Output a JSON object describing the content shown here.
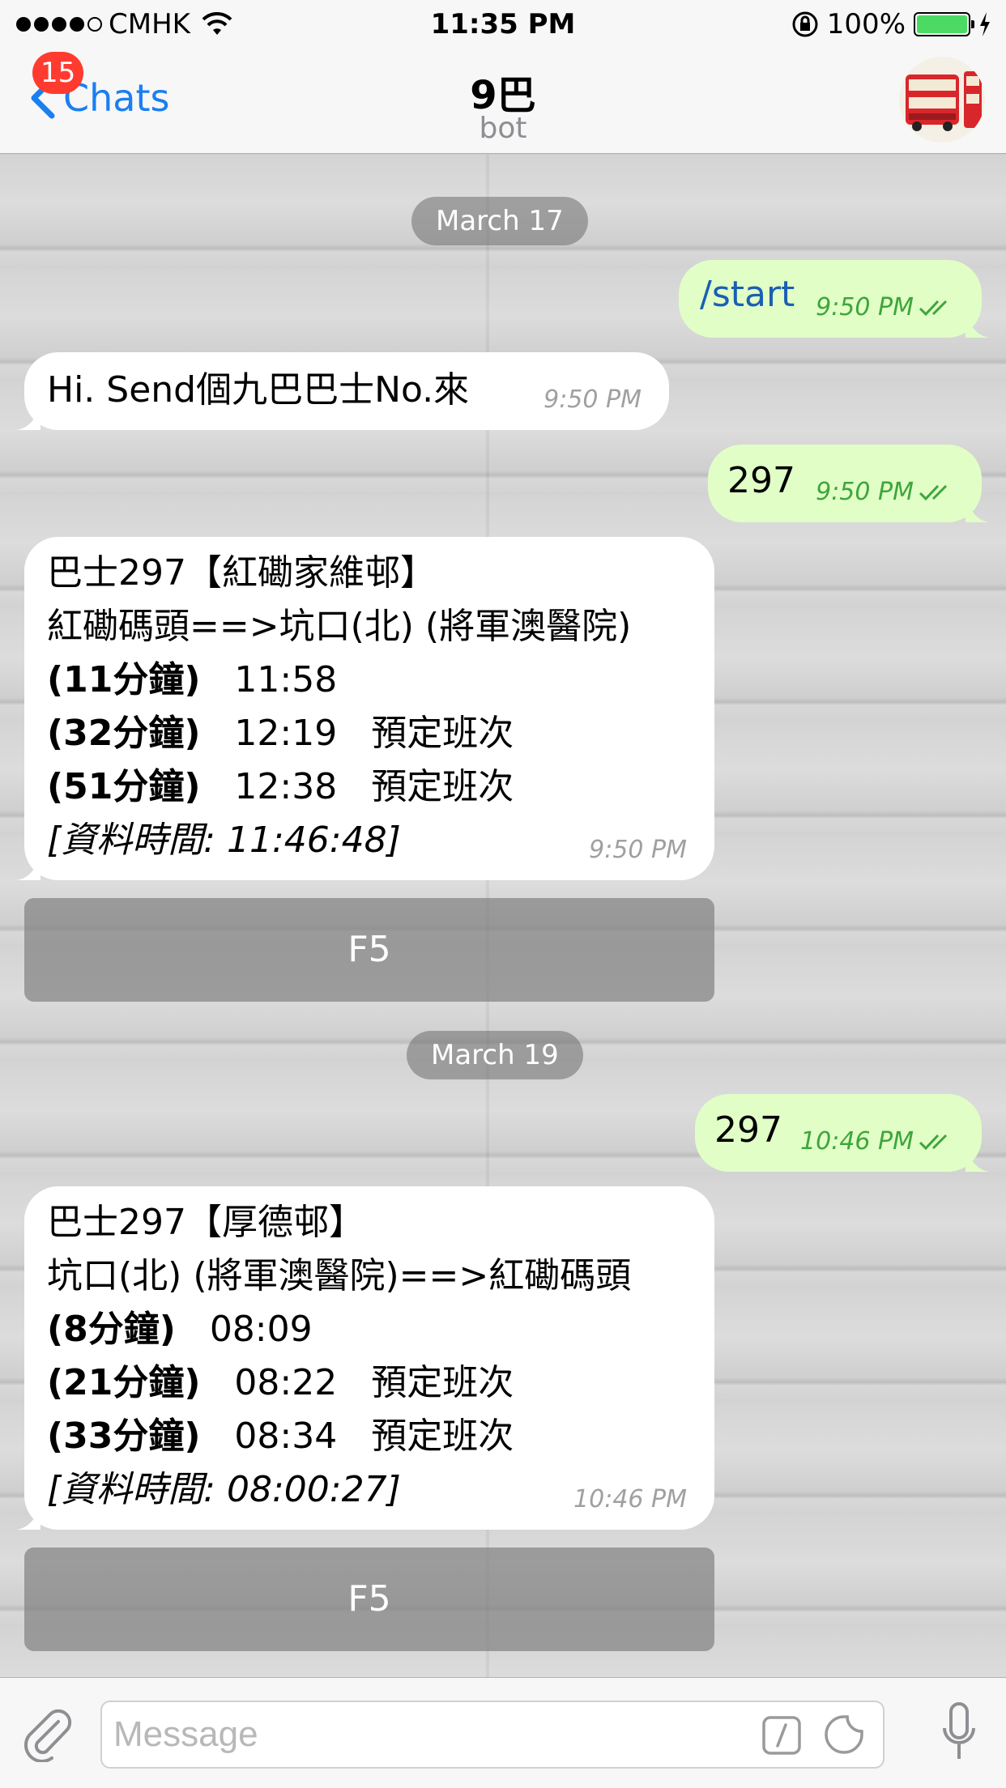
{
  "status_bar": {
    "carrier": "CMHK",
    "time": "11:35 PM",
    "battery": "100%",
    "battery_color": "#4cd964"
  },
  "nav": {
    "back_label": "Chats",
    "unread_badge": "15",
    "title": "9巴",
    "subtitle": "bot",
    "back_color": "#1a7ff0",
    "badge_color": "#ff3b30"
  },
  "chat": {
    "date_1": "March 17",
    "date_2": "March 19",
    "msg_start": {
      "text": "/start",
      "time": "9:50 PM"
    },
    "msg_hi": {
      "text": "Hi. Send個九巴巴士No.來",
      "time": "9:50 PM"
    },
    "msg_297_a": {
      "text": "297",
      "time": "9:50 PM"
    },
    "bot_reply_1": {
      "title": "巴士297【紅磡家維邨】",
      "route": "紅磡碼頭==>坑口(北) (將軍澳醫院)",
      "rows": [
        {
          "eta": "(11分鐘)",
          "time": "11:58",
          "note": ""
        },
        {
          "eta": "(32分鐘)",
          "time": "12:19",
          "note": "預定班次"
        },
        {
          "eta": "(51分鐘)",
          "time": "12:38",
          "note": "預定班次"
        }
      ],
      "data_time_label": "[資料時間: ",
      "data_time_value": "11:46:48]",
      "time": "9:50 PM"
    },
    "button_1": "F5",
    "msg_297_b": {
      "text": "297",
      "time": "10:46 PM"
    },
    "bot_reply_2": {
      "title": "巴士297【厚德邨】",
      "route": "坑口(北) (將軍澳醫院)==>紅磡碼頭",
      "rows": [
        {
          "eta": "(8分鐘)",
          "time": "08:09",
          "note": ""
        },
        {
          "eta": "(21分鐘)",
          "time": "08:22",
          "note": "預定班次"
        },
        {
          "eta": "(33分鐘)",
          "time": "08:34",
          "note": "預定班次"
        }
      ],
      "data_time_label": "[資料時間: ",
      "data_time_value": "08:00:27]",
      "time": "10:46 PM"
    },
    "button_2": "F5",
    "incoming_bubble_color": "#ffffff",
    "outgoing_bubble_color": "#e1fec6",
    "read_check_color": "#3fa53c"
  },
  "input": {
    "placeholder": "Message"
  },
  "icons": {
    "back": "chevron-left-icon",
    "wifi": "wifi-icon",
    "rotation_lock": "rotation-lock-icon",
    "charging": "bolt-icon",
    "attach": "paperclip-icon",
    "command": "slash-command-icon",
    "sticker": "sticker-icon",
    "mic": "microphone-icon",
    "read_receipt": "double-check-icon"
  }
}
